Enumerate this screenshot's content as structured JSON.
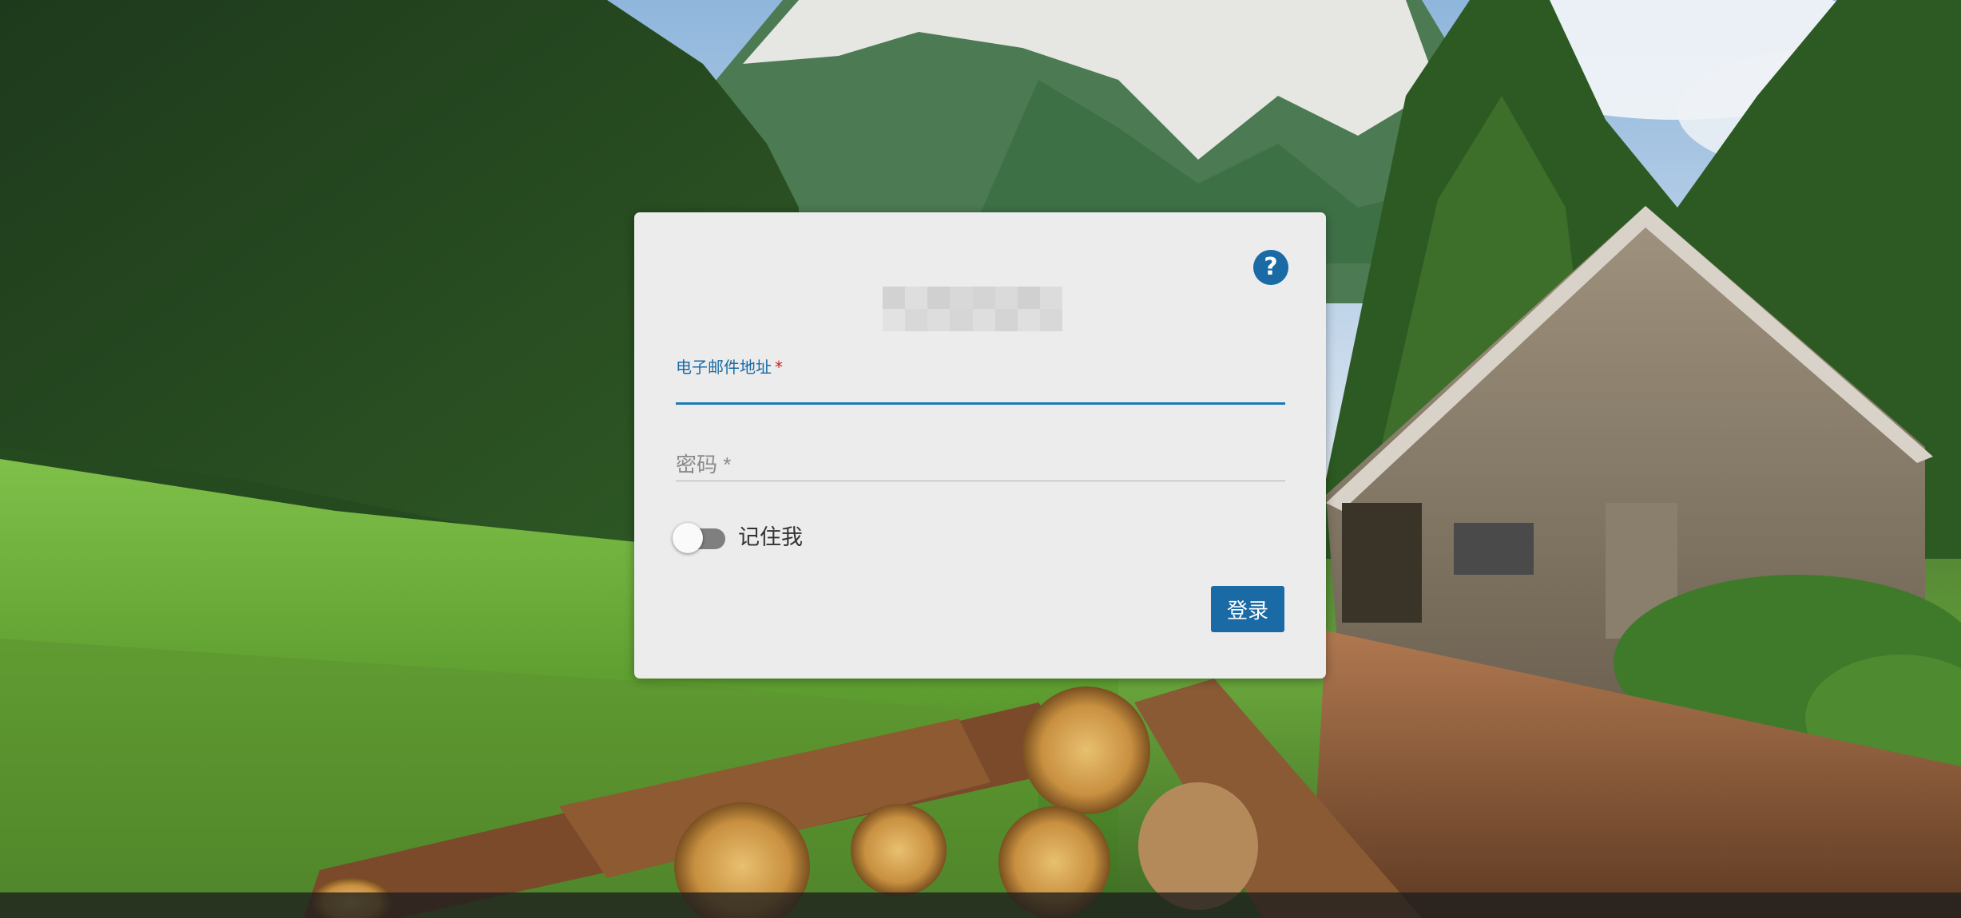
{
  "background": {
    "description_icon": "mountain-forest-cabin-logs-photo"
  },
  "login": {
    "help_label": "?",
    "email_label": "电子邮件地址",
    "email_required_mark": "*",
    "email_value": "",
    "password_placeholder": "密码 *",
    "remember_label": "记住我",
    "remember_checked": false,
    "submit_label": "登录"
  },
  "colors": {
    "accent": "#1a6aa5",
    "card_bg": "#ececec",
    "required": "#d02020"
  }
}
